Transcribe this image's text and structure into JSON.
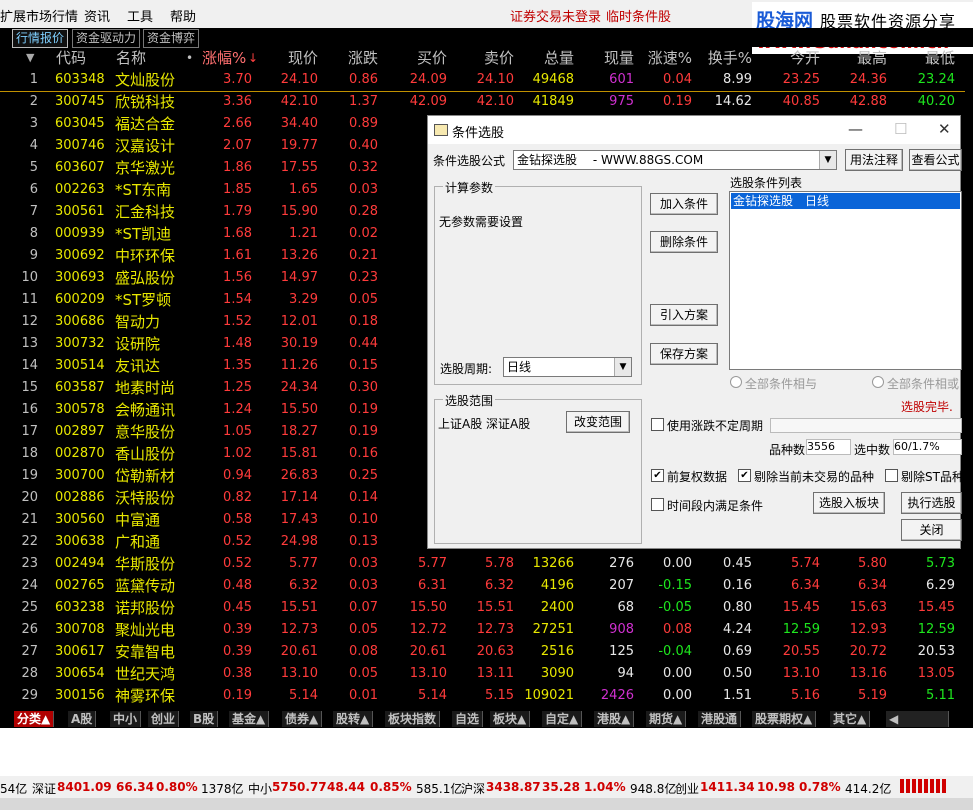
{
  "menu": {
    "items": [
      "扩展市场行情",
      "资讯",
      "工具",
      "帮助"
    ],
    "notices": [
      "证券交易未登录",
      "临时条件股"
    ]
  },
  "watermark": {
    "line1": "股海网",
    "line2": "股票软件资源分享",
    "line3": "www.Guhai.com.cn"
  },
  "tabs": [
    "行情报价",
    "资金驱动力",
    "资金博弈"
  ],
  "table": {
    "headers": [
      "代码",
      "名称",
      "•",
      "涨幅%",
      "现价",
      "涨跌",
      "买价",
      "卖价",
      "总量",
      "现量",
      "涨速%",
      "换手%",
      "今开",
      "最高",
      "最低"
    ],
    "rows": [
      {
        "i": "1",
        "code": "603348",
        "name": "文灿股份",
        "chg": "3.70",
        "price": "24.10",
        "diff": "0.86",
        "buy": "24.09",
        "sell": "24.10",
        "vol": "49468",
        "cur": "601",
        "speed": "0.04",
        "turn": "8.99",
        "open": "23.25",
        "high": "24.36",
        "low": "23.24"
      },
      {
        "i": "2",
        "code": "300745",
        "name": "欣锐科技",
        "chg": "3.36",
        "price": "42.10",
        "diff": "1.37",
        "buy": "42.09",
        "sell": "42.10",
        "vol": "41849",
        "cur": "975",
        "speed": "0.19",
        "turn": "14.62",
        "open": "40.85",
        "high": "42.88",
        "low": "40.20"
      },
      {
        "i": "3",
        "code": "603045",
        "name": "福达合金",
        "chg": "2.66",
        "price": "34.40",
        "diff": "0.89",
        "buy": "34",
        "sell": "",
        "vol": "",
        "cur": "",
        "speed": "",
        "turn": "",
        "open": "",
        "high": "",
        "low": ""
      },
      {
        "i": "4",
        "code": "300746",
        "name": "汉嘉设计",
        "chg": "2.07",
        "price": "19.77",
        "diff": "0.40",
        "buy": "19",
        "sell": "",
        "vol": "",
        "cur": "",
        "speed": "",
        "turn": "",
        "open": "",
        "high": "",
        "low": ""
      },
      {
        "i": "5",
        "code": "603607",
        "name": "京华激光",
        "chg": "1.86",
        "price": "17.55",
        "diff": "0.32",
        "buy": "17",
        "sell": "",
        "vol": "",
        "cur": "",
        "speed": "",
        "turn": "",
        "open": "",
        "high": "",
        "low": ""
      },
      {
        "i": "6",
        "code": "002263",
        "name": "*ST东南",
        "chg": "1.85",
        "price": "1.65",
        "diff": "0.03",
        "buy": "1",
        "sell": "",
        "vol": "",
        "cur": "",
        "speed": "",
        "turn": "",
        "open": "",
        "high": "",
        "low": ""
      },
      {
        "i": "7",
        "code": "300561",
        "name": "汇金科技",
        "chg": "1.79",
        "price": "15.90",
        "diff": "0.28",
        "buy": "15",
        "sell": "",
        "vol": "",
        "cur": "",
        "speed": "",
        "turn": "",
        "open": "",
        "high": "",
        "low": ""
      },
      {
        "i": "8",
        "code": "000939",
        "name": "*ST凯迪",
        "chg": "1.68",
        "price": "1.21",
        "diff": "0.02",
        "buy": "1",
        "sell": "",
        "vol": "",
        "cur": "",
        "speed": "",
        "turn": "",
        "open": "",
        "high": "",
        "low": ""
      },
      {
        "i": "9",
        "code": "300692",
        "name": "中环环保",
        "chg": "1.61",
        "price": "13.26",
        "diff": "0.21",
        "buy": "13",
        "sell": "",
        "vol": "",
        "cur": "",
        "speed": "",
        "turn": "",
        "open": "",
        "high": "",
        "low": ""
      },
      {
        "i": "10",
        "code": "300693",
        "name": "盛弘股份",
        "chg": "1.56",
        "price": "14.97",
        "diff": "0.23",
        "buy": "14",
        "sell": "",
        "vol": "",
        "cur": "",
        "speed": "",
        "turn": "",
        "open": "",
        "high": "",
        "low": ""
      },
      {
        "i": "11",
        "code": "600209",
        "name": "*ST罗顿",
        "chg": "1.54",
        "price": "3.29",
        "diff": "0.05",
        "buy": "3",
        "sell": "",
        "vol": "",
        "cur": "",
        "speed": "",
        "turn": "",
        "open": "",
        "high": "",
        "low": ""
      },
      {
        "i": "12",
        "code": "300686",
        "name": "智动力",
        "chg": "1.52",
        "price": "12.01",
        "diff": "0.18",
        "buy": "12",
        "sell": "",
        "vol": "",
        "cur": "",
        "speed": "",
        "turn": "",
        "open": "",
        "high": "",
        "low": ""
      },
      {
        "i": "13",
        "code": "300732",
        "name": "设研院",
        "chg": "1.48",
        "price": "30.19",
        "diff": "0.44",
        "buy": "30",
        "sell": "",
        "vol": "",
        "cur": "",
        "speed": "",
        "turn": "",
        "open": "",
        "high": "",
        "low": ""
      },
      {
        "i": "14",
        "code": "300514",
        "name": "友讯达",
        "chg": "1.35",
        "price": "11.26",
        "diff": "0.15",
        "buy": "11",
        "sell": "",
        "vol": "",
        "cur": "",
        "speed": "",
        "turn": "",
        "open": "",
        "high": "",
        "low": ""
      },
      {
        "i": "15",
        "code": "603587",
        "name": "地素时尚",
        "chg": "1.25",
        "price": "24.34",
        "diff": "0.30",
        "buy": "24",
        "sell": "",
        "vol": "",
        "cur": "",
        "speed": "",
        "turn": "",
        "open": "",
        "high": "",
        "low": ""
      },
      {
        "i": "16",
        "code": "300578",
        "name": "会畅通讯",
        "chg": "1.24",
        "price": "15.50",
        "diff": "0.19",
        "buy": "15",
        "sell": "",
        "vol": "",
        "cur": "",
        "speed": "",
        "turn": "",
        "open": "",
        "high": "",
        "low": ""
      },
      {
        "i": "17",
        "code": "002897",
        "name": "意华股份",
        "chg": "1.05",
        "price": "18.27",
        "diff": "0.19",
        "buy": "18",
        "sell": "",
        "vol": "",
        "cur": "",
        "speed": "",
        "turn": "",
        "open": "",
        "high": "",
        "low": ""
      },
      {
        "i": "18",
        "code": "002870",
        "name": "香山股份",
        "chg": "1.02",
        "price": "15.81",
        "diff": "0.16",
        "buy": "15",
        "sell": "",
        "vol": "",
        "cur": "",
        "speed": "",
        "turn": "",
        "open": "",
        "high": "",
        "low": ""
      },
      {
        "i": "19",
        "code": "300700",
        "name": "岱勒新材",
        "chg": "0.94",
        "price": "26.83",
        "diff": "0.25",
        "buy": "26",
        "sell": "",
        "vol": "",
        "cur": "",
        "speed": "",
        "turn": "",
        "open": "",
        "high": "",
        "low": ""
      },
      {
        "i": "20",
        "code": "002886",
        "name": "沃特股份",
        "chg": "0.82",
        "price": "17.14",
        "diff": "0.14",
        "buy": "17",
        "sell": "",
        "vol": "",
        "cur": "",
        "speed": "",
        "turn": "",
        "open": "",
        "high": "",
        "low": ""
      },
      {
        "i": "21",
        "code": "300560",
        "name": "中富通",
        "chg": "0.58",
        "price": "17.43",
        "diff": "0.10",
        "buy": "17",
        "sell": "",
        "vol": "",
        "cur": "",
        "speed": "",
        "turn": "",
        "open": "",
        "high": "",
        "low": ""
      },
      {
        "i": "22",
        "code": "300638",
        "name": "广和通",
        "chg": "0.52",
        "price": "24.98",
        "diff": "0.13",
        "buy": "24",
        "sell": "",
        "vol": "",
        "cur": "",
        "speed": "",
        "turn": "",
        "open": "",
        "high": "",
        "low": ""
      },
      {
        "i": "23",
        "code": "002494",
        "name": "华斯股份",
        "chg": "0.52",
        "price": "5.77",
        "diff": "0.03",
        "buy": "5.77",
        "sell": "5.78",
        "vol": "13266",
        "cur": "276",
        "speed": "0.00",
        "turn": "0.45",
        "open": "5.74",
        "high": "5.80",
        "low": "5.73"
      },
      {
        "i": "24",
        "code": "002765",
        "name": "蓝黛传动",
        "chg": "0.48",
        "price": "6.32",
        "diff": "0.03",
        "buy": "6.31",
        "sell": "6.32",
        "vol": "4196",
        "cur": "207",
        "speed": "-0.15",
        "turn": "0.16",
        "open": "6.34",
        "high": "6.34",
        "low": "6.29"
      },
      {
        "i": "25",
        "code": "603238",
        "name": "诺邦股份",
        "chg": "0.45",
        "price": "15.51",
        "diff": "0.07",
        "buy": "15.50",
        "sell": "15.51",
        "vol": "2400",
        "cur": "68",
        "speed": "-0.05",
        "turn": "0.80",
        "open": "15.45",
        "high": "15.63",
        "low": "15.45"
      },
      {
        "i": "26",
        "code": "300708",
        "name": "聚灿光电",
        "chg": "0.39",
        "price": "12.73",
        "diff": "0.05",
        "buy": "12.72",
        "sell": "12.73",
        "vol": "27251",
        "cur": "908",
        "speed": "0.08",
        "turn": "4.24",
        "open": "12.59",
        "high": "12.93",
        "low": "12.59"
      },
      {
        "i": "27",
        "code": "300617",
        "name": "安靠智电",
        "chg": "0.39",
        "price": "20.61",
        "diff": "0.08",
        "buy": "20.61",
        "sell": "20.63",
        "vol": "2516",
        "cur": "125",
        "speed": "-0.04",
        "turn": "0.69",
        "open": "20.55",
        "high": "20.72",
        "low": "20.53"
      },
      {
        "i": "28",
        "code": "300654",
        "name": "世纪天鸿",
        "chg": "0.38",
        "price": "13.10",
        "diff": "0.05",
        "buy": "13.10",
        "sell": "13.11",
        "vol": "3090",
        "cur": "94",
        "speed": "0.00",
        "turn": "0.50",
        "open": "13.10",
        "high": "13.16",
        "low": "13.05"
      },
      {
        "i": "29",
        "code": "300156",
        "name": "神雾环保",
        "chg": "0.19",
        "price": "5.14",
        "diff": "0.01",
        "buy": "5.14",
        "sell": "5.15",
        "vol": "109021",
        "cur": "2426",
        "speed": "0.00",
        "turn": "1.51",
        "open": "5.16",
        "high": "5.19",
        "low": "5.11"
      }
    ]
  },
  "dialog": {
    "title": "条件选股",
    "formula_label": "条件选股公式",
    "formula_value": "金钻探选股　 - WWW.88GS.COM",
    "btn_usage": "用法注释",
    "btn_view": "查看公式",
    "params_group": "计算参数",
    "params_text": "无参数需要设置",
    "period_label": "选股周期:",
    "period_value": "日线",
    "btn_add": "加入条件",
    "btn_delete": "删除条件",
    "btn_import": "引入方案",
    "btn_save": "保存方案",
    "list_label": "选股条件列表",
    "list_item": "金钻探选股　日线",
    "radio_and": "全部条件相与",
    "radio_or": "全部条件相或",
    "done_text": "选股完毕.",
    "range_group": "选股范围",
    "range_text": "上证A股 深证A股",
    "btn_change_range": "改变范围",
    "chk_uncertain": "使用涨跌不定周期",
    "count_label": "品种数",
    "count_value": "3556",
    "selected_label": "选中数",
    "selected_value": "60/1.7%",
    "chk_prereinstate": "前复权数据",
    "chk_exclude_untraded": "剔除当前未交易的品种",
    "chk_exclude_st": "剔除ST品种",
    "chk_time_period": "时间段内满足条件",
    "btn_to_block": "选股入板块",
    "btn_execute": "执行选股",
    "btn_close": "关闭"
  },
  "bottom_tabs": [
    "分类▲",
    "A股",
    "中小",
    "创业",
    "B股",
    "基金▲",
    "债券▲",
    "股转▲",
    "板块指数",
    "自选",
    "板块▲",
    "自定▲",
    "港股▲",
    "期货▲",
    "港股通",
    "股票期权▲",
    "其它▲"
  ],
  "status": {
    "s1": "54亿",
    "sz_label": "深证",
    "sz_val": "8401.09",
    "sz_chg": "66.34",
    "sz_pct": "0.80%",
    "s2": "1378亿",
    "zx_label": "中小",
    "zx_val": "5750.77",
    "zx_chg": "48.44",
    "zx_pct": "0.85%",
    "s3": "585.1亿",
    "hs_label": "沪深",
    "hs_val": "3438.87",
    "hs_chg": "35.28",
    "hs_pct": "1.04%",
    "s4": "948.8亿",
    "cy_label": "创业",
    "cy_val": "1411.34",
    "cy_chg": "10.98",
    "cy_pct": "0.78%",
    "s5": "414.2亿"
  },
  "colors": {
    "up": "#ff3b3b",
    "down": "#1ee61e",
    "code": "#e8e800",
    "accent": "#c00000"
  }
}
